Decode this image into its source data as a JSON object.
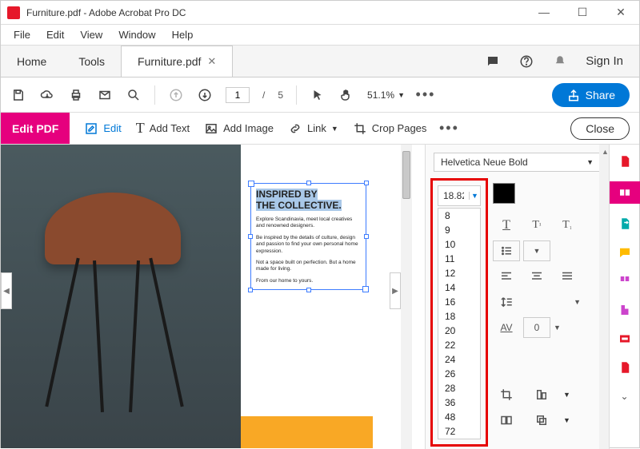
{
  "titlebar": {
    "title": "Furniture.pdf - Adobe Acrobat Pro DC"
  },
  "menubar": {
    "file": "File",
    "edit": "Edit",
    "view": "View",
    "window": "Window",
    "help": "Help"
  },
  "tabs": {
    "home": "Home",
    "tools": "Tools",
    "doc": "Furniture.pdf",
    "signin": "Sign In"
  },
  "toolbar": {
    "page": "1",
    "pagesep": "/",
    "pagecount": "5",
    "zoom": "51.1%",
    "share": "Share"
  },
  "editbar": {
    "editpdf": "Edit PDF",
    "edit": "Edit",
    "addtext": "Add Text",
    "addimage": "Add Image",
    "link": "Link",
    "croppages": "Crop Pages",
    "close": "Close"
  },
  "doc": {
    "title1": "INSPIRED BY",
    "title2": "THE COLLECTIVE.",
    "p1": "Explore Scandinavia, meet local creatives and renowned designers.",
    "p2": "Be inspired by the details of culture, design and passion to find your own personal home expression.",
    "p3": "Not a space built on perfection. But a home made for living.",
    "p4": "From our home to yours."
  },
  "format": {
    "font": "Helvetica Neue Bold",
    "size": "18.82",
    "sizes": [
      "8",
      "9",
      "10",
      "11",
      "12",
      "14",
      "16",
      "18",
      "20",
      "22",
      "24",
      "26",
      "28",
      "36",
      "48",
      "72"
    ],
    "spacing": "0"
  }
}
